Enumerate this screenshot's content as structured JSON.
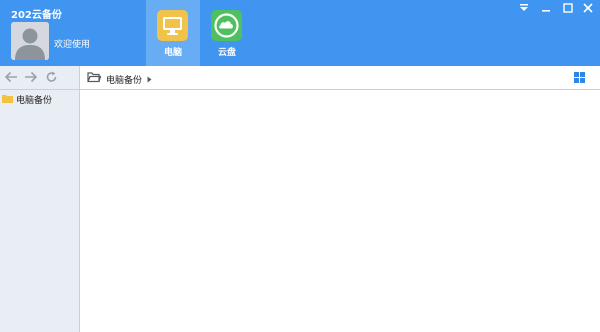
{
  "app": {
    "title": "202云备份"
  },
  "user": {
    "welcome": "欢迎使用",
    "avatar_icon": "default-avatar-icon"
  },
  "nav": {
    "active": "computer",
    "tabs": [
      {
        "id": "computer",
        "label": "电脑",
        "icon": "monitor-icon",
        "color": "#f2c34a"
      },
      {
        "id": "cloud",
        "label": "云盘",
        "icon": "cloud-icon",
        "color": "#4fc05f"
      }
    ]
  },
  "window_controls": [
    "menu-dropdown-icon",
    "minimize-icon",
    "maximize-icon",
    "close-icon"
  ],
  "toolbar": {
    "back_icon": "arrow-left-icon",
    "forward_icon": "arrow-right-icon",
    "refresh_icon": "refresh-icon",
    "folder_icon": "folder-open-icon",
    "path": "电脑备份",
    "view_icon": "grid-view-icon"
  },
  "sidebar": {
    "items": [
      {
        "label": "电脑备份",
        "icon": "folder-icon"
      }
    ]
  },
  "colors": {
    "header_bg": "#3f95ef",
    "active_tab_bg": "#68acf3",
    "sidebar_bg": "#e9eef5",
    "folder": "#f3c243",
    "grid_icon": "#2f86e4"
  }
}
